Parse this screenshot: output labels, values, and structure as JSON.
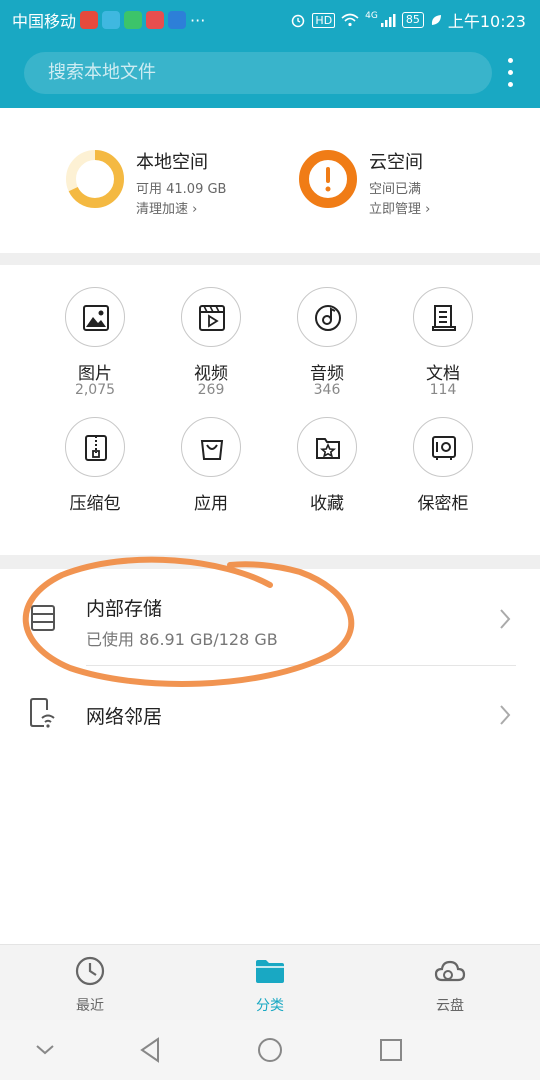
{
  "status_bar": {
    "carrier": "中国移动",
    "hd": "HD",
    "signal": "4G",
    "battery": "85",
    "time": "上午10:23",
    "more_apps": "···"
  },
  "search": {
    "placeholder": "搜索本地文件"
  },
  "storage": {
    "local": {
      "title": "本地空间",
      "available": "可用 41.09 GB",
      "action": "清理加速 ›"
    },
    "cloud": {
      "title": "云空间",
      "status": "空间已满",
      "action": "立即管理 ›"
    }
  },
  "categories": [
    {
      "label": "图片",
      "count": "2,075",
      "icon": "image-icon"
    },
    {
      "label": "视频",
      "count": "269",
      "icon": "video-icon"
    },
    {
      "label": "音频",
      "count": "346",
      "icon": "audio-icon"
    },
    {
      "label": "文档",
      "count": "114",
      "icon": "document-icon"
    },
    {
      "label": "压缩包",
      "icon": "archive-icon"
    },
    {
      "label": "应用",
      "icon": "app-bag-icon"
    },
    {
      "label": "收藏",
      "icon": "favorite-star-icon"
    },
    {
      "label": "保密柜",
      "icon": "safe-icon"
    }
  ],
  "internal_storage": {
    "title": "内部存储",
    "usage": "已使用 86.91 GB/128 GB"
  },
  "network": {
    "title": "网络邻居"
  },
  "tabs": [
    {
      "label": "最近",
      "icon": "clock-icon"
    },
    {
      "label": "分类",
      "icon": "folder-icon",
      "active": true
    },
    {
      "label": "云盘",
      "icon": "cloud-icon"
    }
  ],
  "colors": {
    "accent": "#19a8c3",
    "local_ring": "#f4b942",
    "cloud_ring": "#f07c16",
    "annotation": "#f0883e"
  },
  "progress": {
    "local_used_fraction": 0.68
  }
}
